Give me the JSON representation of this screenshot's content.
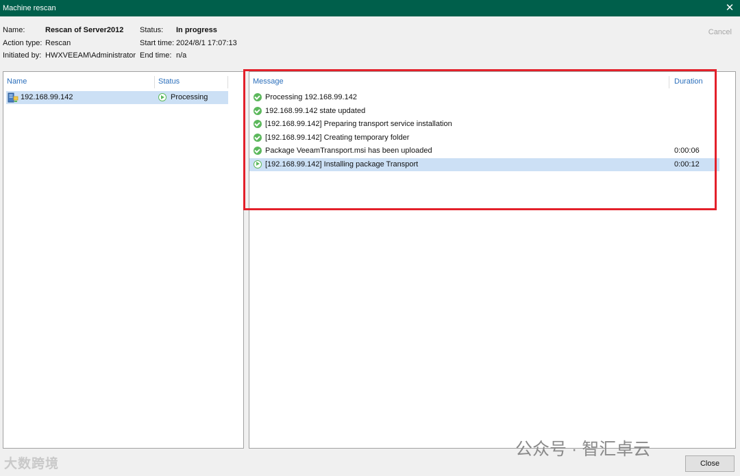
{
  "window": {
    "title": "Machine rescan"
  },
  "info": {
    "name_label": "Name:",
    "name_value": "Rescan of Server2012",
    "action_label": "Action type:",
    "action_value": "Rescan",
    "initiated_label": "Initiated by:",
    "initiated_value": "HWXVEEAM\\Administrator",
    "status_label": "Status:",
    "status_value": "In progress",
    "start_label": "Start time:",
    "start_value": "2024/8/1 17:07:13",
    "end_label": "End time:",
    "end_value": "n/a"
  },
  "buttons": {
    "cancel": "Cancel",
    "close": "Close"
  },
  "left_table": {
    "headers": [
      "Name",
      "Status"
    ],
    "rows": [
      {
        "name": "192.168.99.142",
        "status": "Processing"
      }
    ]
  },
  "right_table": {
    "headers": [
      "Message",
      "Duration"
    ],
    "rows": [
      {
        "message": "Processing 192.168.99.142",
        "duration": ""
      },
      {
        "message": "192.168.99.142 state updated",
        "duration": ""
      },
      {
        "message": "[192.168.99.142] Preparing transport service installation",
        "duration": ""
      },
      {
        "message": "[192.168.99.142] Creating temporary folder",
        "duration": ""
      },
      {
        "message": "Package VeeamTransport.msi has been uploaded",
        "duration": "0:00:06"
      },
      {
        "message": "[192.168.99.142] Installing package Transport",
        "duration": "0:00:12"
      }
    ]
  },
  "watermarks": {
    "left": "大数跨境",
    "right": "公众号 · 智汇卓云"
  },
  "colors": {
    "titlebar": "#005f4b",
    "header_text": "#2a6ebb",
    "selection": "#cce0f5",
    "success": "#5cb85c",
    "highlight": "#e3202a"
  }
}
